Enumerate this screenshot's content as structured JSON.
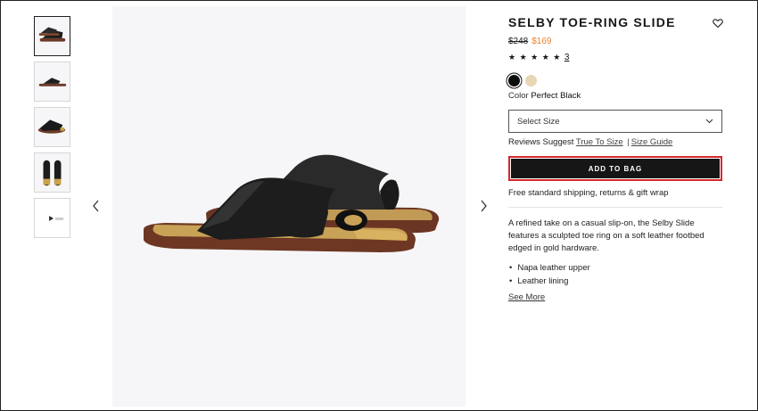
{
  "product": {
    "title": "SELBY TOE-RING SLIDE",
    "price_old": "$248",
    "price_new": "$169",
    "stars": "★ ★ ★ ★ ★",
    "review_count": "3",
    "color_label": "Color",
    "color_value": "Perfect Black",
    "size_placeholder": "Select Size",
    "reviews_suggest_label": "Reviews Suggest",
    "true_to_size": "True To Size",
    "separator": "|",
    "size_guide": "Size Guide",
    "add_to_bag": "ADD TO BAG",
    "shipping": "Free standard shipping, returns & gift wrap",
    "description": "A refined take on a casual slip-on, the Selby Slide features a sculpted toe ring on a soft leather footbed edged in gold hardware.",
    "bullets": [
      "Napa leather upper",
      "Leather lining"
    ],
    "see_more": "See More"
  },
  "swatches": [
    {
      "name": "Perfect Black",
      "color": "#0c0c0c",
      "selected": true
    },
    {
      "name": "cream",
      "color": "#e6d6b4",
      "selected": false
    }
  ],
  "icons": {
    "heart": "heart-icon",
    "prev": "chevron-left-icon",
    "next": "chevron-right-icon",
    "dropdown": "chevron-down-icon"
  },
  "colors": {
    "sale_price": "#e8842c",
    "highlight_border": "#d4282d",
    "button_bg": "#161616"
  }
}
